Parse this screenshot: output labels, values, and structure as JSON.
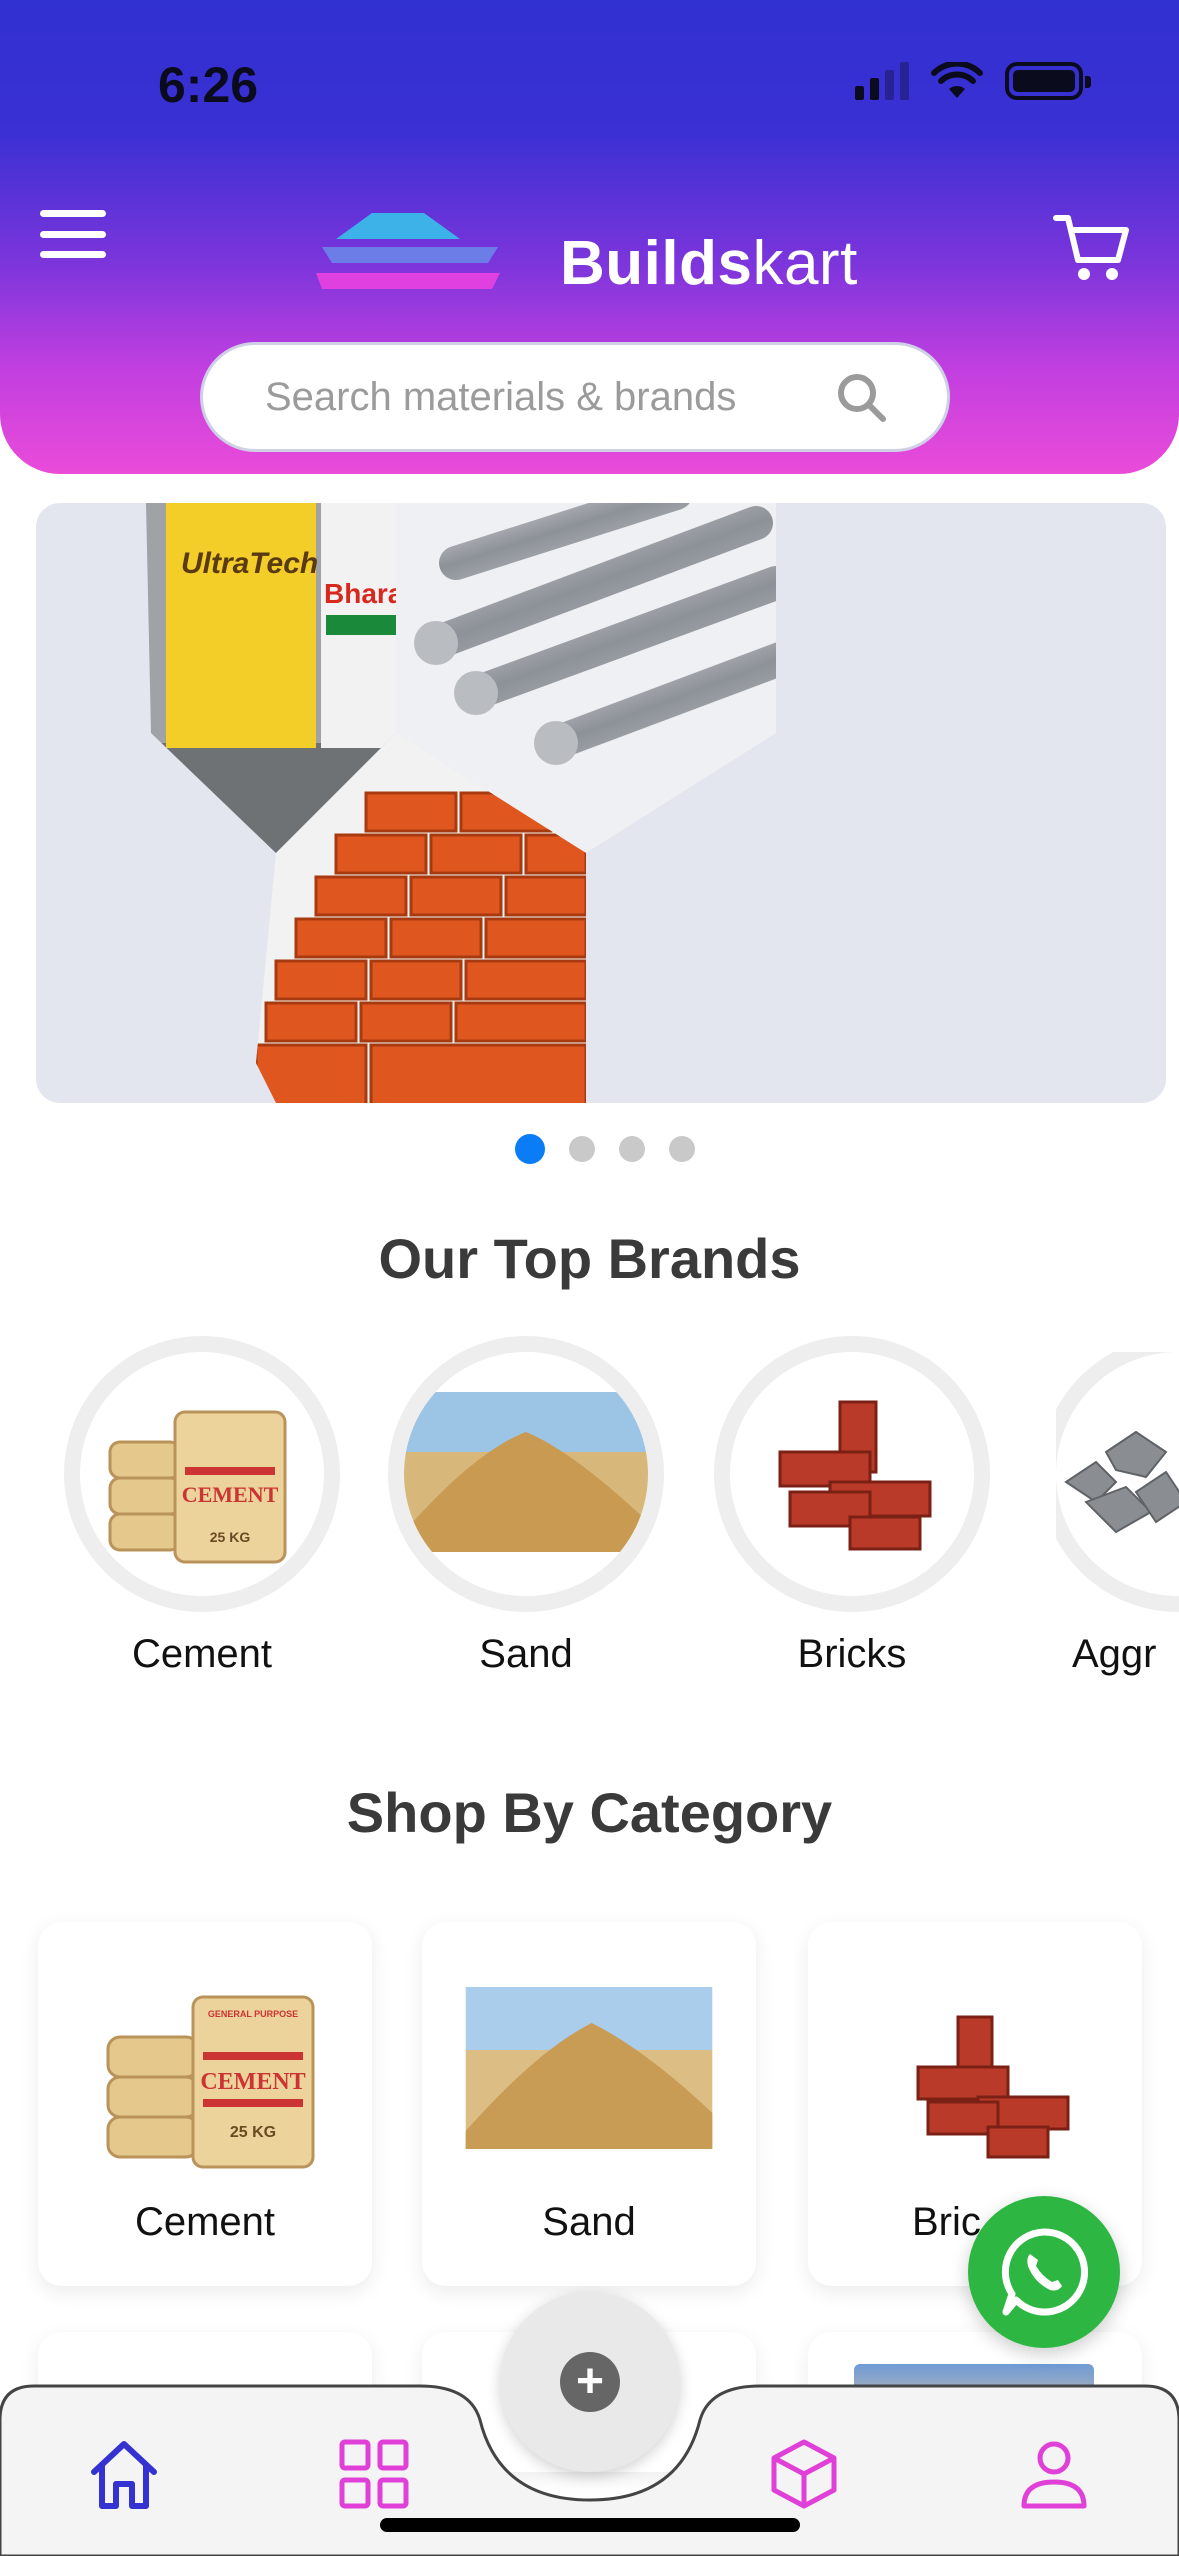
{
  "status_bar": {
    "time": "6:26"
  },
  "header": {
    "brand_bold": "Builds",
    "brand_regular": "kart"
  },
  "search": {
    "placeholder": "Search materials & brands"
  },
  "banner": {
    "slides": 4,
    "active_slide": 1,
    "cement_brand_1": "UltraTech Super",
    "cement_brand_2": "Bharathi"
  },
  "top_brands": {
    "title": "Our Top Brands",
    "items": [
      {
        "label": "Cement"
      },
      {
        "label": "Sand"
      },
      {
        "label": "Bricks"
      },
      {
        "label": "Aggr"
      }
    ]
  },
  "categories": {
    "title": "Shop By Category",
    "items": [
      {
        "label": "Cement"
      },
      {
        "label": "Sand"
      },
      {
        "label": "Bric"
      }
    ]
  },
  "cement_bag_text": {
    "header": "GENERAL PURPOSE",
    "name": "CEMENT",
    "weight": "25 KG"
  },
  "colors": {
    "primary": "#3130d1",
    "accent": "#ea4bd9",
    "active_dot": "#0a7cf5",
    "whatsapp": "#2db742"
  },
  "bottom_nav": {
    "items": [
      "home-icon",
      "grid-icon",
      "add-icon",
      "box-icon",
      "user-icon"
    ]
  }
}
